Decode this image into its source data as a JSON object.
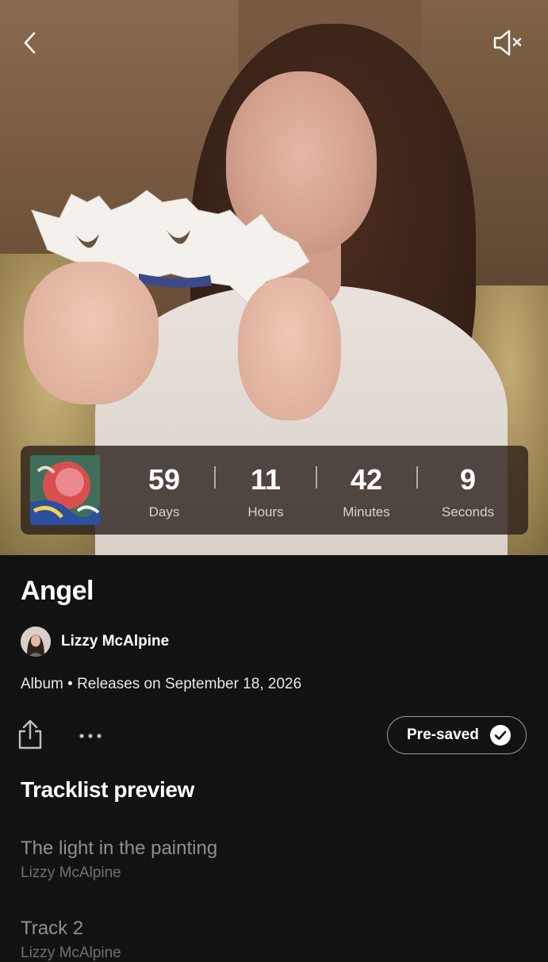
{
  "hero": {
    "back_icon": "chevron-left-icon",
    "mute_icon": "speaker-muted-icon"
  },
  "countdown": {
    "units": [
      {
        "value": "59",
        "label": "Days"
      },
      {
        "value": "11",
        "label": "Hours"
      },
      {
        "value": "42",
        "label": "Minutes"
      },
      {
        "value": "9",
        "label": "Seconds"
      }
    ]
  },
  "album": {
    "title": "Angel",
    "artist": "Lizzy McAlpine",
    "meta": "Album • Releases on September 18, 2026"
  },
  "actions": {
    "share_icon": "share-icon",
    "more_icon": "more-horizontal-icon",
    "presave_label": "Pre-saved",
    "presave_icon": "check-circle-icon"
  },
  "tracklist": {
    "heading": "Tracklist preview",
    "tracks": [
      {
        "title": "The light in the painting",
        "artist": "Lizzy McAlpine"
      },
      {
        "title": "Track 2",
        "artist": "Lizzy McAlpine"
      }
    ]
  },
  "colors": {
    "background": "#121212",
    "text_primary": "#ffffff",
    "text_muted": "#8f8f8f",
    "overlay": "#281e18"
  }
}
